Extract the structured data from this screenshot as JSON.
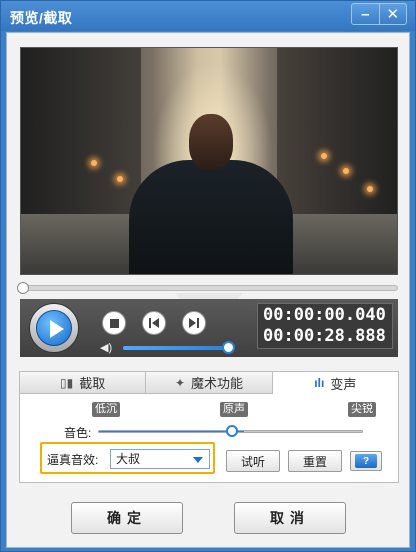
{
  "window": {
    "title": "预览/截取",
    "minimize_icon": "minimize-icon",
    "close_icon": "close-icon"
  },
  "player": {
    "current_time": "00:00:00.040",
    "total_time": "00:00:28.888",
    "volume_fraction": 0.85,
    "timeline_fraction": 0.0
  },
  "tabs": [
    {
      "label": "截取",
      "icon": "crop-icon",
      "active": false
    },
    {
      "label": "魔术功能",
      "icon": "magic-icon",
      "active": false
    },
    {
      "label": "变声",
      "icon": "waveform-icon",
      "active": true
    }
  ],
  "voice": {
    "presets": [
      "低沉",
      "原声",
      "尖锐"
    ],
    "tone_label": "音色:",
    "tone_fraction": 0.55,
    "effect_label": "逼真音效:",
    "effect_value": "大叔",
    "listen_label": "试听",
    "reset_label": "重置",
    "help_icon": "help-icon"
  },
  "footer": {
    "ok_label": "确定",
    "cancel_label": "取消"
  },
  "colors": {
    "accent": "#2b7fd8",
    "titlebar": "#3f7fc4",
    "highlight_border": "#f0b000"
  }
}
